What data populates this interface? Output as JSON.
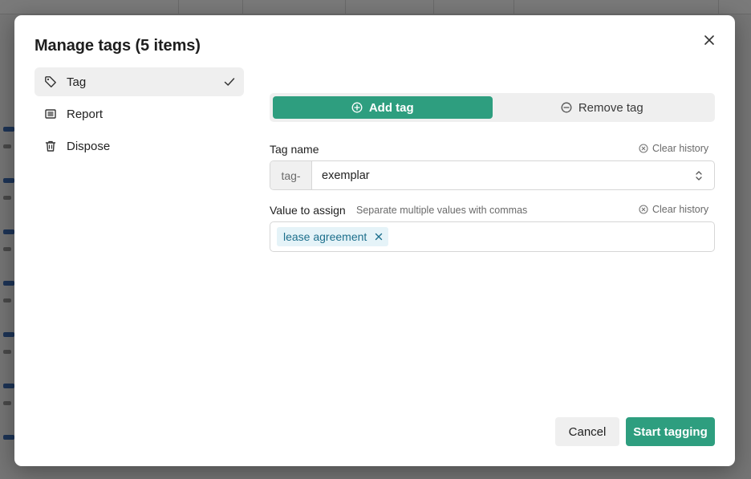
{
  "modal": {
    "title": "Manage tags (5 items)"
  },
  "menu": {
    "items": [
      {
        "label": "Tag",
        "icon": "tag-icon",
        "active": true
      },
      {
        "label": "Report",
        "icon": "report-icon",
        "active": false
      },
      {
        "label": "Dispose",
        "icon": "trash-icon",
        "active": false
      }
    ]
  },
  "mode": {
    "add_label": "Add tag",
    "remove_label": "Remove tag",
    "selected": "add"
  },
  "tag_name": {
    "label": "Tag name",
    "clear_history": "Clear history",
    "prefix": "tag-",
    "value": "exemplar"
  },
  "value_assign": {
    "label": "Value to assign",
    "hint": "Separate multiple values with commas",
    "clear_history": "Clear history",
    "chips": [
      "lease agreement"
    ]
  },
  "actions": {
    "cancel": "Cancel",
    "submit": "Start tagging"
  },
  "colors": {
    "accent": "#2e9e7f",
    "chip_bg": "#e5f3f8",
    "chip_text": "#1d6f8c"
  }
}
